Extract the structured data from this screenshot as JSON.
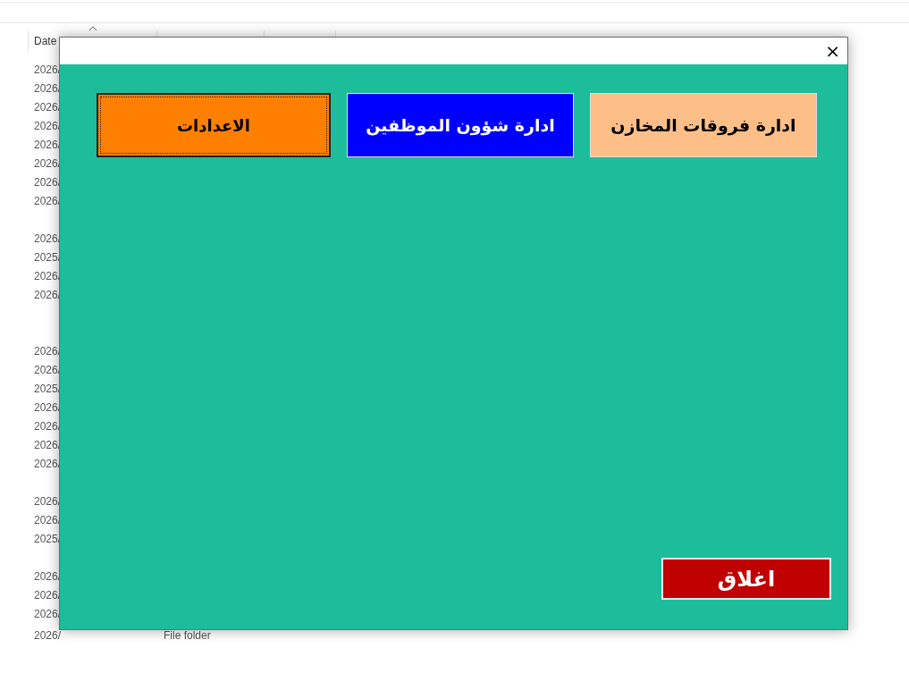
{
  "explorer": {
    "column_header": "Date",
    "groups": [
      {
        "dates": [
          "2026/",
          "2026/",
          "2026/",
          "2026/",
          "2026/",
          "2026/",
          "2026/",
          "2026/"
        ]
      },
      {
        "dates": [
          "2026/",
          "2025/",
          "2026/",
          "2026/"
        ]
      },
      {
        "dates": [
          "2026/",
          "2026/",
          "2025/",
          "2026/",
          "2026/",
          "2026/",
          "2026/"
        ]
      },
      {
        "dates": [
          "2026/",
          "2026/",
          "2025/"
        ]
      },
      {
        "dates": [
          "2026/",
          "2026/",
          "2026/",
          "2026/"
        ]
      }
    ],
    "last_row_type": "File folder"
  },
  "dialog": {
    "close_glyph": "×",
    "buttons": [
      {
        "label": "ادارة فروقات المخازن",
        "color": "#fdbf87",
        "focused": false
      },
      {
        "label": "ادارة شؤون الموظفين",
        "color": "#0000ff",
        "focused": false
      },
      {
        "label": "الاعدادات",
        "color": "#ff8000",
        "focused": true
      }
    ],
    "exit_button": {
      "label": "اغلاق",
      "color": "#c00000"
    }
  }
}
